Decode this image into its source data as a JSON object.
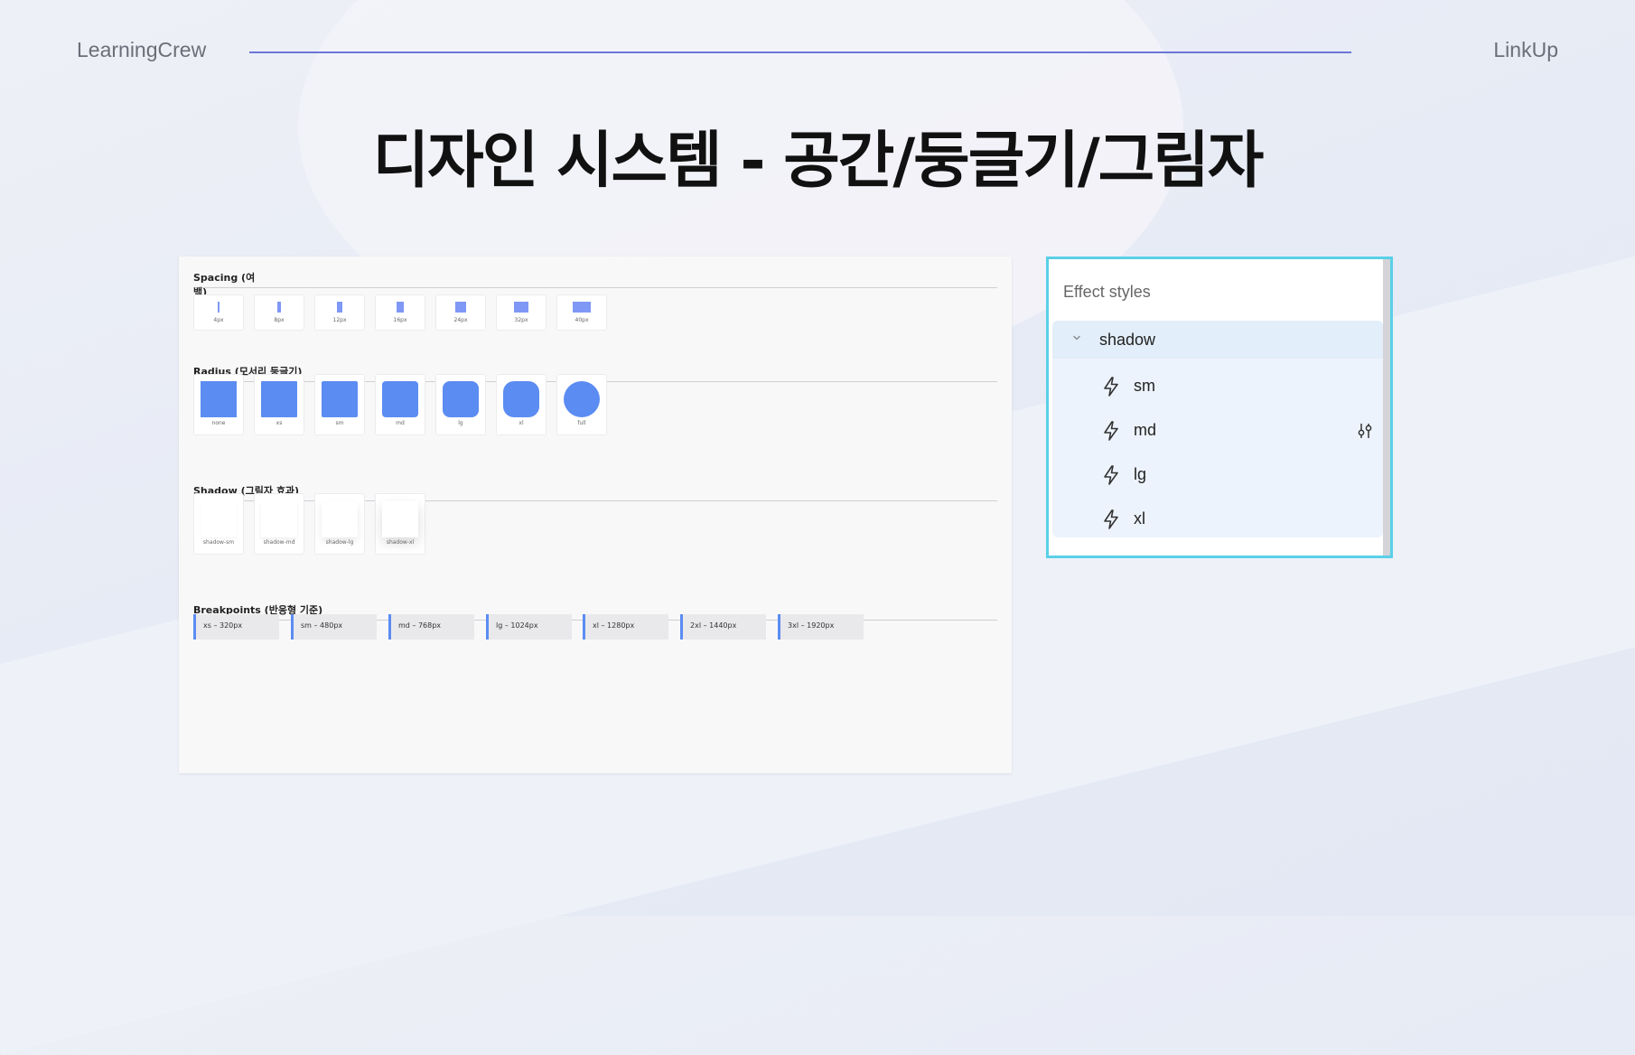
{
  "header": {
    "brand_left": "LearningCrew",
    "brand_right": "LinkUp"
  },
  "title": "디자인 시스템 - 공간/둥글기/그림자",
  "board": {
    "spacing": {
      "title": "Spacing (여백)",
      "items": [
        "4px",
        "8px",
        "12px",
        "16px",
        "24px",
        "32px",
        "40px"
      ]
    },
    "radius": {
      "title": "Radius (모서리 둥글기)",
      "items": [
        "none",
        "xs",
        "sm",
        "md",
        "lg",
        "xl",
        "full"
      ]
    },
    "shadow": {
      "title": "Shadow (그림자 효과)",
      "items": [
        "shadow-sm",
        "shadow-md",
        "shadow-lg",
        "shadow-xl"
      ]
    },
    "breakpoints": {
      "title": "Breakpoints (반응형 기준)",
      "items": [
        "xs – 320px",
        "sm – 480px",
        "md – 768px",
        "lg – 1024px",
        "xl – 1280px",
        "2xl – 1440px",
        "3xl – 1920px"
      ]
    }
  },
  "effect_panel": {
    "title": "Effect styles",
    "group": "shadow",
    "group_icon": "chevron-down-icon",
    "style_icon": "lightning-bolt-icon",
    "adjust_icon": "adjust-sliders-icon",
    "styles": [
      "sm",
      "md",
      "lg",
      "xl"
    ]
  },
  "colors": {
    "accent": "#5b8cf2",
    "panel_border": "#5ad0e8",
    "header_line": "#6c76d8"
  }
}
